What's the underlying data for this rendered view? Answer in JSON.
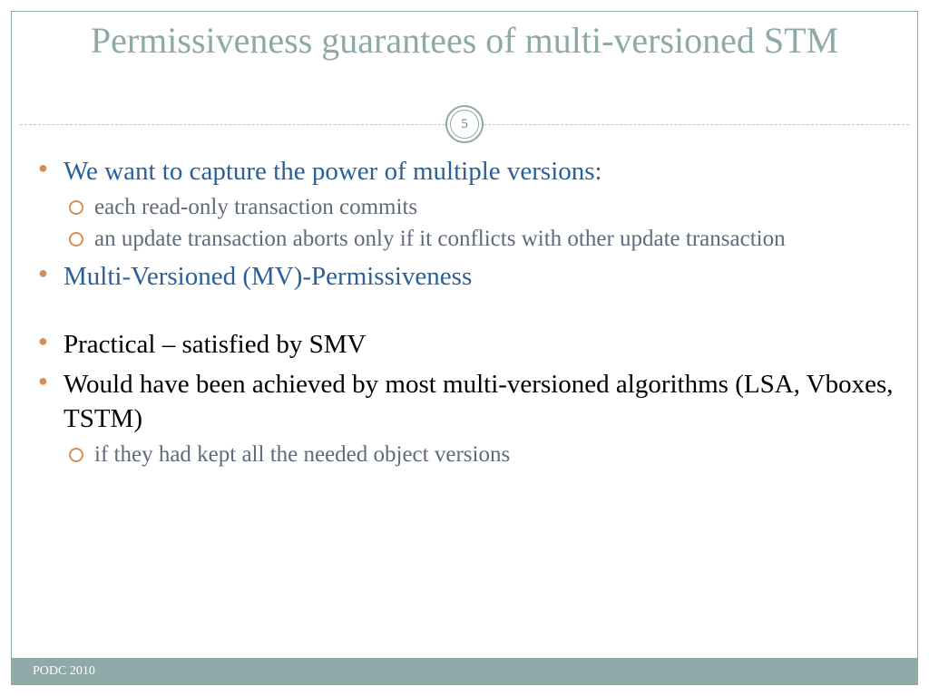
{
  "title": "Permissiveness guarantees of multi-versioned STM",
  "page_number": "5",
  "bullets": {
    "b1": "We want to capture the power of multiple versions:",
    "b1_sub1": "each read-only transaction commits",
    "b1_sub2": "an update transaction aborts only if it conflicts with other update transaction",
    "b2": "Multi-Versioned (MV)-Permissiveness",
    "b3": "Practical – satisfied by SMV",
    "b4": "Would have been achieved by most multi-versioned algorithms (LSA, Vboxes, TSTM)",
    "b4_sub1": "if they had kept all the needed object versions"
  },
  "footer": "PODC 2010"
}
